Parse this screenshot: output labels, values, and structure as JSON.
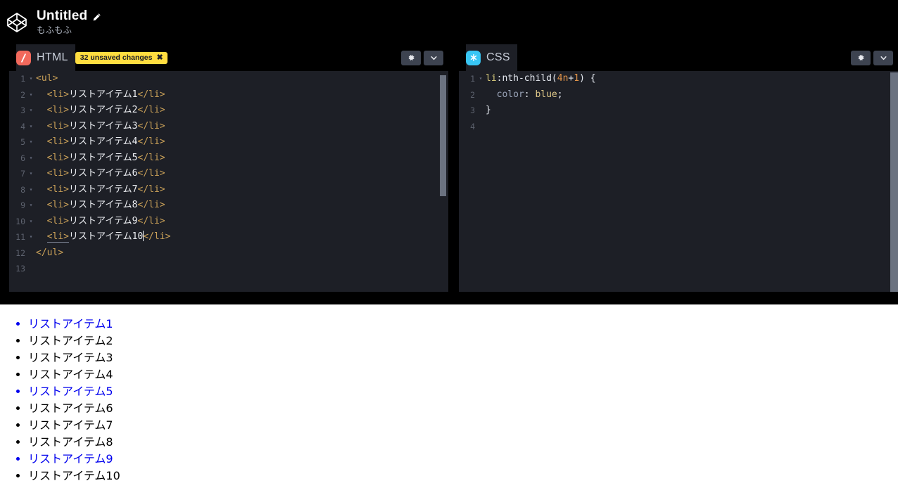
{
  "topbar": {
    "logo_icon": "codepen-logo-icon",
    "pen_title": "Untitled",
    "edit_icon": "pencil-icon",
    "author": "もふもふ"
  },
  "panes": [
    {
      "id": "html",
      "lang_label": "HTML",
      "badge_icon": "html-slash-icon",
      "badge_color": "#f2695c",
      "unsaved_label": "32 unsaved changes",
      "unsaved_close_icon": "close-icon",
      "settings_icon": "gear-icon",
      "collapse_icon": "chevron-down-icon",
      "lines": [
        {
          "n": "1",
          "fold": "▾",
          "segments": [
            {
              "c": "tag",
              "t": "<ul>"
            }
          ]
        },
        {
          "n": "2",
          "fold": "▾",
          "segments": [
            {
              "c": "txt",
              "t": "  "
            },
            {
              "c": "tag",
              "t": "<li>"
            },
            {
              "c": "txt",
              "t": "リストアイテム1"
            },
            {
              "c": "tag",
              "t": "</li>"
            }
          ]
        },
        {
          "n": "3",
          "fold": "▾",
          "segments": [
            {
              "c": "txt",
              "t": "  "
            },
            {
              "c": "tag",
              "t": "<li>"
            },
            {
              "c": "txt",
              "t": "リストアイテム2"
            },
            {
              "c": "tag",
              "t": "</li>"
            }
          ]
        },
        {
          "n": "4",
          "fold": "▾",
          "segments": [
            {
              "c": "txt",
              "t": "  "
            },
            {
              "c": "tag",
              "t": "<li>"
            },
            {
              "c": "txt",
              "t": "リストアイテム3"
            },
            {
              "c": "tag",
              "t": "</li>"
            }
          ]
        },
        {
          "n": "5",
          "fold": "▾",
          "segments": [
            {
              "c": "txt",
              "t": "  "
            },
            {
              "c": "tag",
              "t": "<li>"
            },
            {
              "c": "txt",
              "t": "リストアイテム4"
            },
            {
              "c": "tag",
              "t": "</li>"
            }
          ]
        },
        {
          "n": "6",
          "fold": "▾",
          "segments": [
            {
              "c": "txt",
              "t": "  "
            },
            {
              "c": "tag",
              "t": "<li>"
            },
            {
              "c": "txt",
              "t": "リストアイテム5"
            },
            {
              "c": "tag",
              "t": "</li>"
            }
          ]
        },
        {
          "n": "7",
          "fold": "▾",
          "segments": [
            {
              "c": "txt",
              "t": "  "
            },
            {
              "c": "tag",
              "t": "<li>"
            },
            {
              "c": "txt",
              "t": "リストアイテム6"
            },
            {
              "c": "tag",
              "t": "</li>"
            }
          ]
        },
        {
          "n": "8",
          "fold": "▾",
          "segments": [
            {
              "c": "txt",
              "t": "  "
            },
            {
              "c": "tag",
              "t": "<li>"
            },
            {
              "c": "txt",
              "t": "リストアイテム7"
            },
            {
              "c": "tag",
              "t": "</li>"
            }
          ]
        },
        {
          "n": "9",
          "fold": "▾",
          "segments": [
            {
              "c": "txt",
              "t": "  "
            },
            {
              "c": "tag",
              "t": "<li>"
            },
            {
              "c": "txt",
              "t": "リストアイテム8"
            },
            {
              "c": "tag",
              "t": "</li>"
            }
          ]
        },
        {
          "n": "10",
          "fold": "▾",
          "segments": [
            {
              "c": "txt",
              "t": "  "
            },
            {
              "c": "tag",
              "t": "<li>"
            },
            {
              "c": "txt",
              "t": "リストアイテム9"
            },
            {
              "c": "tag",
              "t": "</li>"
            }
          ]
        },
        {
          "n": "11",
          "fold": "▾",
          "segments": [
            {
              "c": "txt",
              "t": "  "
            },
            {
              "c": "u-tag",
              "t": "<li>"
            },
            {
              "c": "txt",
              "t": "リストアイテム10"
            },
            {
              "c": "caret",
              "t": ""
            },
            {
              "c": "tag",
              "t": "</li>"
            }
          ]
        },
        {
          "n": "12",
          "fold": "",
          "segments": [
            {
              "c": "tag",
              "t": "</ul>"
            }
          ]
        },
        {
          "n": "13",
          "fold": "",
          "segments": [
            {
              "c": "txt",
              "t": ""
            }
          ]
        }
      ]
    },
    {
      "id": "css",
      "lang_label": "CSS",
      "badge_icon": "css-asterisk-icon",
      "badge_color": "#38c6f4",
      "unsaved_label": "",
      "settings_icon": "gear-icon",
      "collapse_icon": "chevron-down-icon",
      "lines": [
        {
          "n": "1",
          "fold": "▾",
          "segments": [
            {
              "c": "selel",
              "t": "li"
            },
            {
              "c": "sel",
              "t": ":nth-child("
            },
            {
              "c": "num",
              "t": "4n"
            },
            {
              "c": "sel",
              "t": "+"
            },
            {
              "c": "num",
              "t": "1"
            },
            {
              "c": "sel",
              "t": ") {"
            }
          ]
        },
        {
          "n": "2",
          "fold": "",
          "segments": [
            {
              "c": "txt",
              "t": "  "
            },
            {
              "c": "prop",
              "t": "color"
            },
            {
              "c": "punc",
              "t": ": "
            },
            {
              "c": "val",
              "t": "blue"
            },
            {
              "c": "punc",
              "t": ";"
            }
          ]
        },
        {
          "n": "3",
          "fold": "",
          "segments": [
            {
              "c": "punc",
              "t": "}"
            }
          ]
        },
        {
          "n": "4",
          "fold": "",
          "segments": [
            {
              "c": "txt",
              "t": ""
            }
          ]
        }
      ]
    }
  ],
  "preview": {
    "items": [
      {
        "label": "リストアイテム1",
        "blue": true
      },
      {
        "label": "リストアイテム2",
        "blue": false
      },
      {
        "label": "リストアイテム3",
        "blue": false
      },
      {
        "label": "リストアイテム4",
        "blue": false
      },
      {
        "label": "リストアイテム5",
        "blue": true
      },
      {
        "label": "リストアイテム6",
        "blue": false
      },
      {
        "label": "リストアイテム7",
        "blue": false
      },
      {
        "label": "リストアイテム8",
        "blue": false
      },
      {
        "label": "リストアイテム9",
        "blue": true
      },
      {
        "label": "リストアイテム10",
        "blue": false
      }
    ],
    "link_color": "#0000ee",
    "text_color": "#000000"
  }
}
